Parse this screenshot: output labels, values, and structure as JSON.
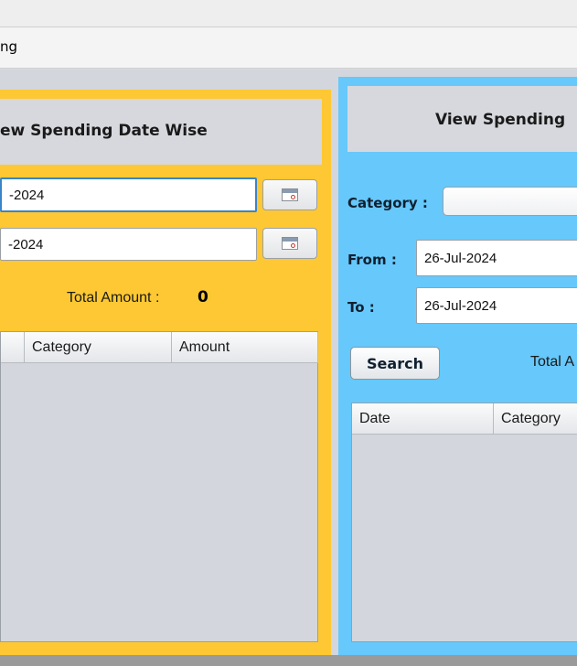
{
  "window": {
    "tab_label_partial": "ng"
  },
  "date_wise": {
    "title_partial": "ew Spending Date Wise",
    "from_value_partial": "-2024",
    "to_value_partial": "-2024",
    "total_label": "Total Amount :",
    "total_value": "0",
    "columns": [
      "Category",
      "Amount"
    ]
  },
  "category_wise": {
    "title_partial": "View Spending",
    "category_label": "Category :",
    "category_value": "",
    "from_label": "From :",
    "from_value": "26-Jul-2024",
    "to_label": "To :",
    "to_value": "26-Jul-2024",
    "search_label": "Search",
    "total_label_partial": "Total A",
    "columns": [
      "Date",
      "Category"
    ]
  },
  "icons": {
    "calendar": "calendar-icon"
  },
  "colors": {
    "left_panel": "#fdc833",
    "right_panel": "#66c8fb",
    "header_bg": "#d6d8dd",
    "focus_border": "#3a84c9"
  }
}
